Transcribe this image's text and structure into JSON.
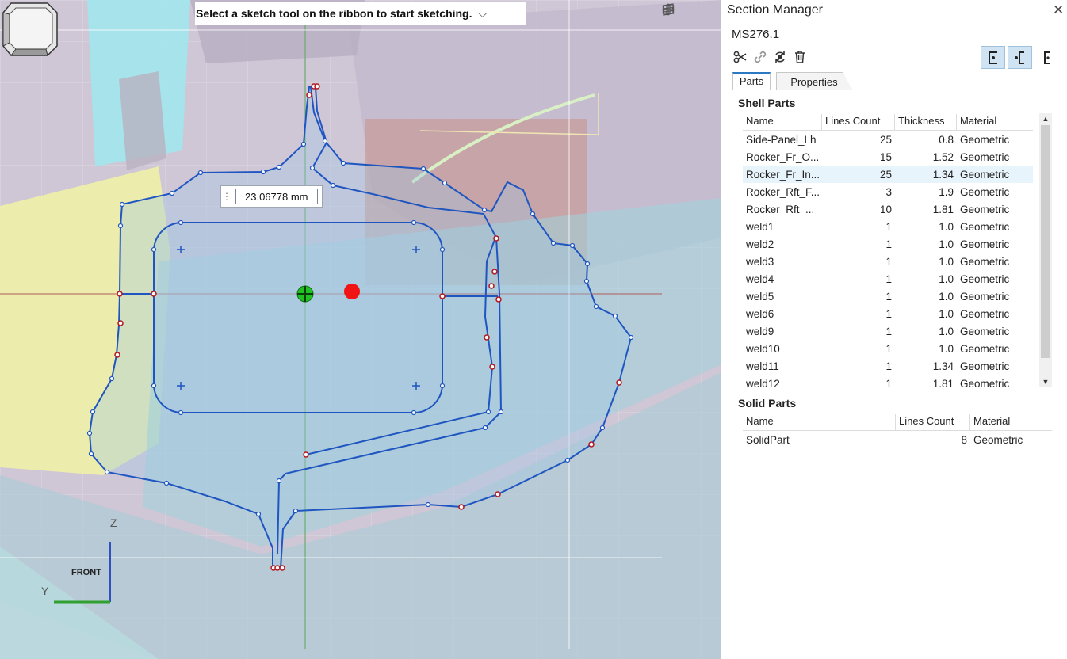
{
  "viewport": {
    "hint": "Select a sketch tool on the ribbon to start sketching.",
    "dimension_value": "23.06778 mm",
    "axis_z": "Z",
    "axis_y": "Y",
    "view_cube_label": "FRONT"
  },
  "panel": {
    "title": "Section Manager",
    "section_name": "MS276.1",
    "tabs": [
      {
        "label": "Parts"
      },
      {
        "label": "Properties"
      }
    ],
    "shell_title": "Shell Parts",
    "shell_columns": {
      "name": "Name",
      "lines": "Lines Count",
      "thickness": "Thickness",
      "material": "Material"
    },
    "shell_rows": [
      {
        "name": "Side-Panel_Lh",
        "lines": "25",
        "thickness": "0.8",
        "material": "Geometric"
      },
      {
        "name": "Rocker_Fr_O...",
        "lines": "15",
        "thickness": "1.52",
        "material": "Geometric"
      },
      {
        "name": "Rocker_Fr_In...",
        "lines": "25",
        "thickness": "1.34",
        "material": "Geometric"
      },
      {
        "name": "Rocker_Rft_F...",
        "lines": "3",
        "thickness": "1.9",
        "material": "Geometric"
      },
      {
        "name": "Rocker_Rft_...",
        "lines": "10",
        "thickness": "1.81",
        "material": "Geometric"
      },
      {
        "name": "weld1",
        "lines": "1",
        "thickness": "1.0",
        "material": "Geometric"
      },
      {
        "name": "weld2",
        "lines": "1",
        "thickness": "1.0",
        "material": "Geometric"
      },
      {
        "name": "weld3",
        "lines": "1",
        "thickness": "1.0",
        "material": "Geometric"
      },
      {
        "name": "weld4",
        "lines": "1",
        "thickness": "1.0",
        "material": "Geometric"
      },
      {
        "name": "weld5",
        "lines": "1",
        "thickness": "1.0",
        "material": "Geometric"
      },
      {
        "name": "weld6",
        "lines": "1",
        "thickness": "1.0",
        "material": "Geometric"
      },
      {
        "name": "weld9",
        "lines": "1",
        "thickness": "1.0",
        "material": "Geometric"
      },
      {
        "name": "weld10",
        "lines": "1",
        "thickness": "1.0",
        "material": "Geometric"
      },
      {
        "name": "weld11",
        "lines": "1",
        "thickness": "1.34",
        "material": "Geometric"
      },
      {
        "name": "weld12",
        "lines": "1",
        "thickness": "1.81",
        "material": "Geometric"
      }
    ],
    "solid_title": "Solid Parts",
    "solid_columns": {
      "name": "Name",
      "lines": "Lines Count",
      "material": "Material"
    },
    "solid_rows": [
      {
        "name": "SolidPart",
        "lines": "8",
        "material": "Geometric"
      }
    ]
  }
}
